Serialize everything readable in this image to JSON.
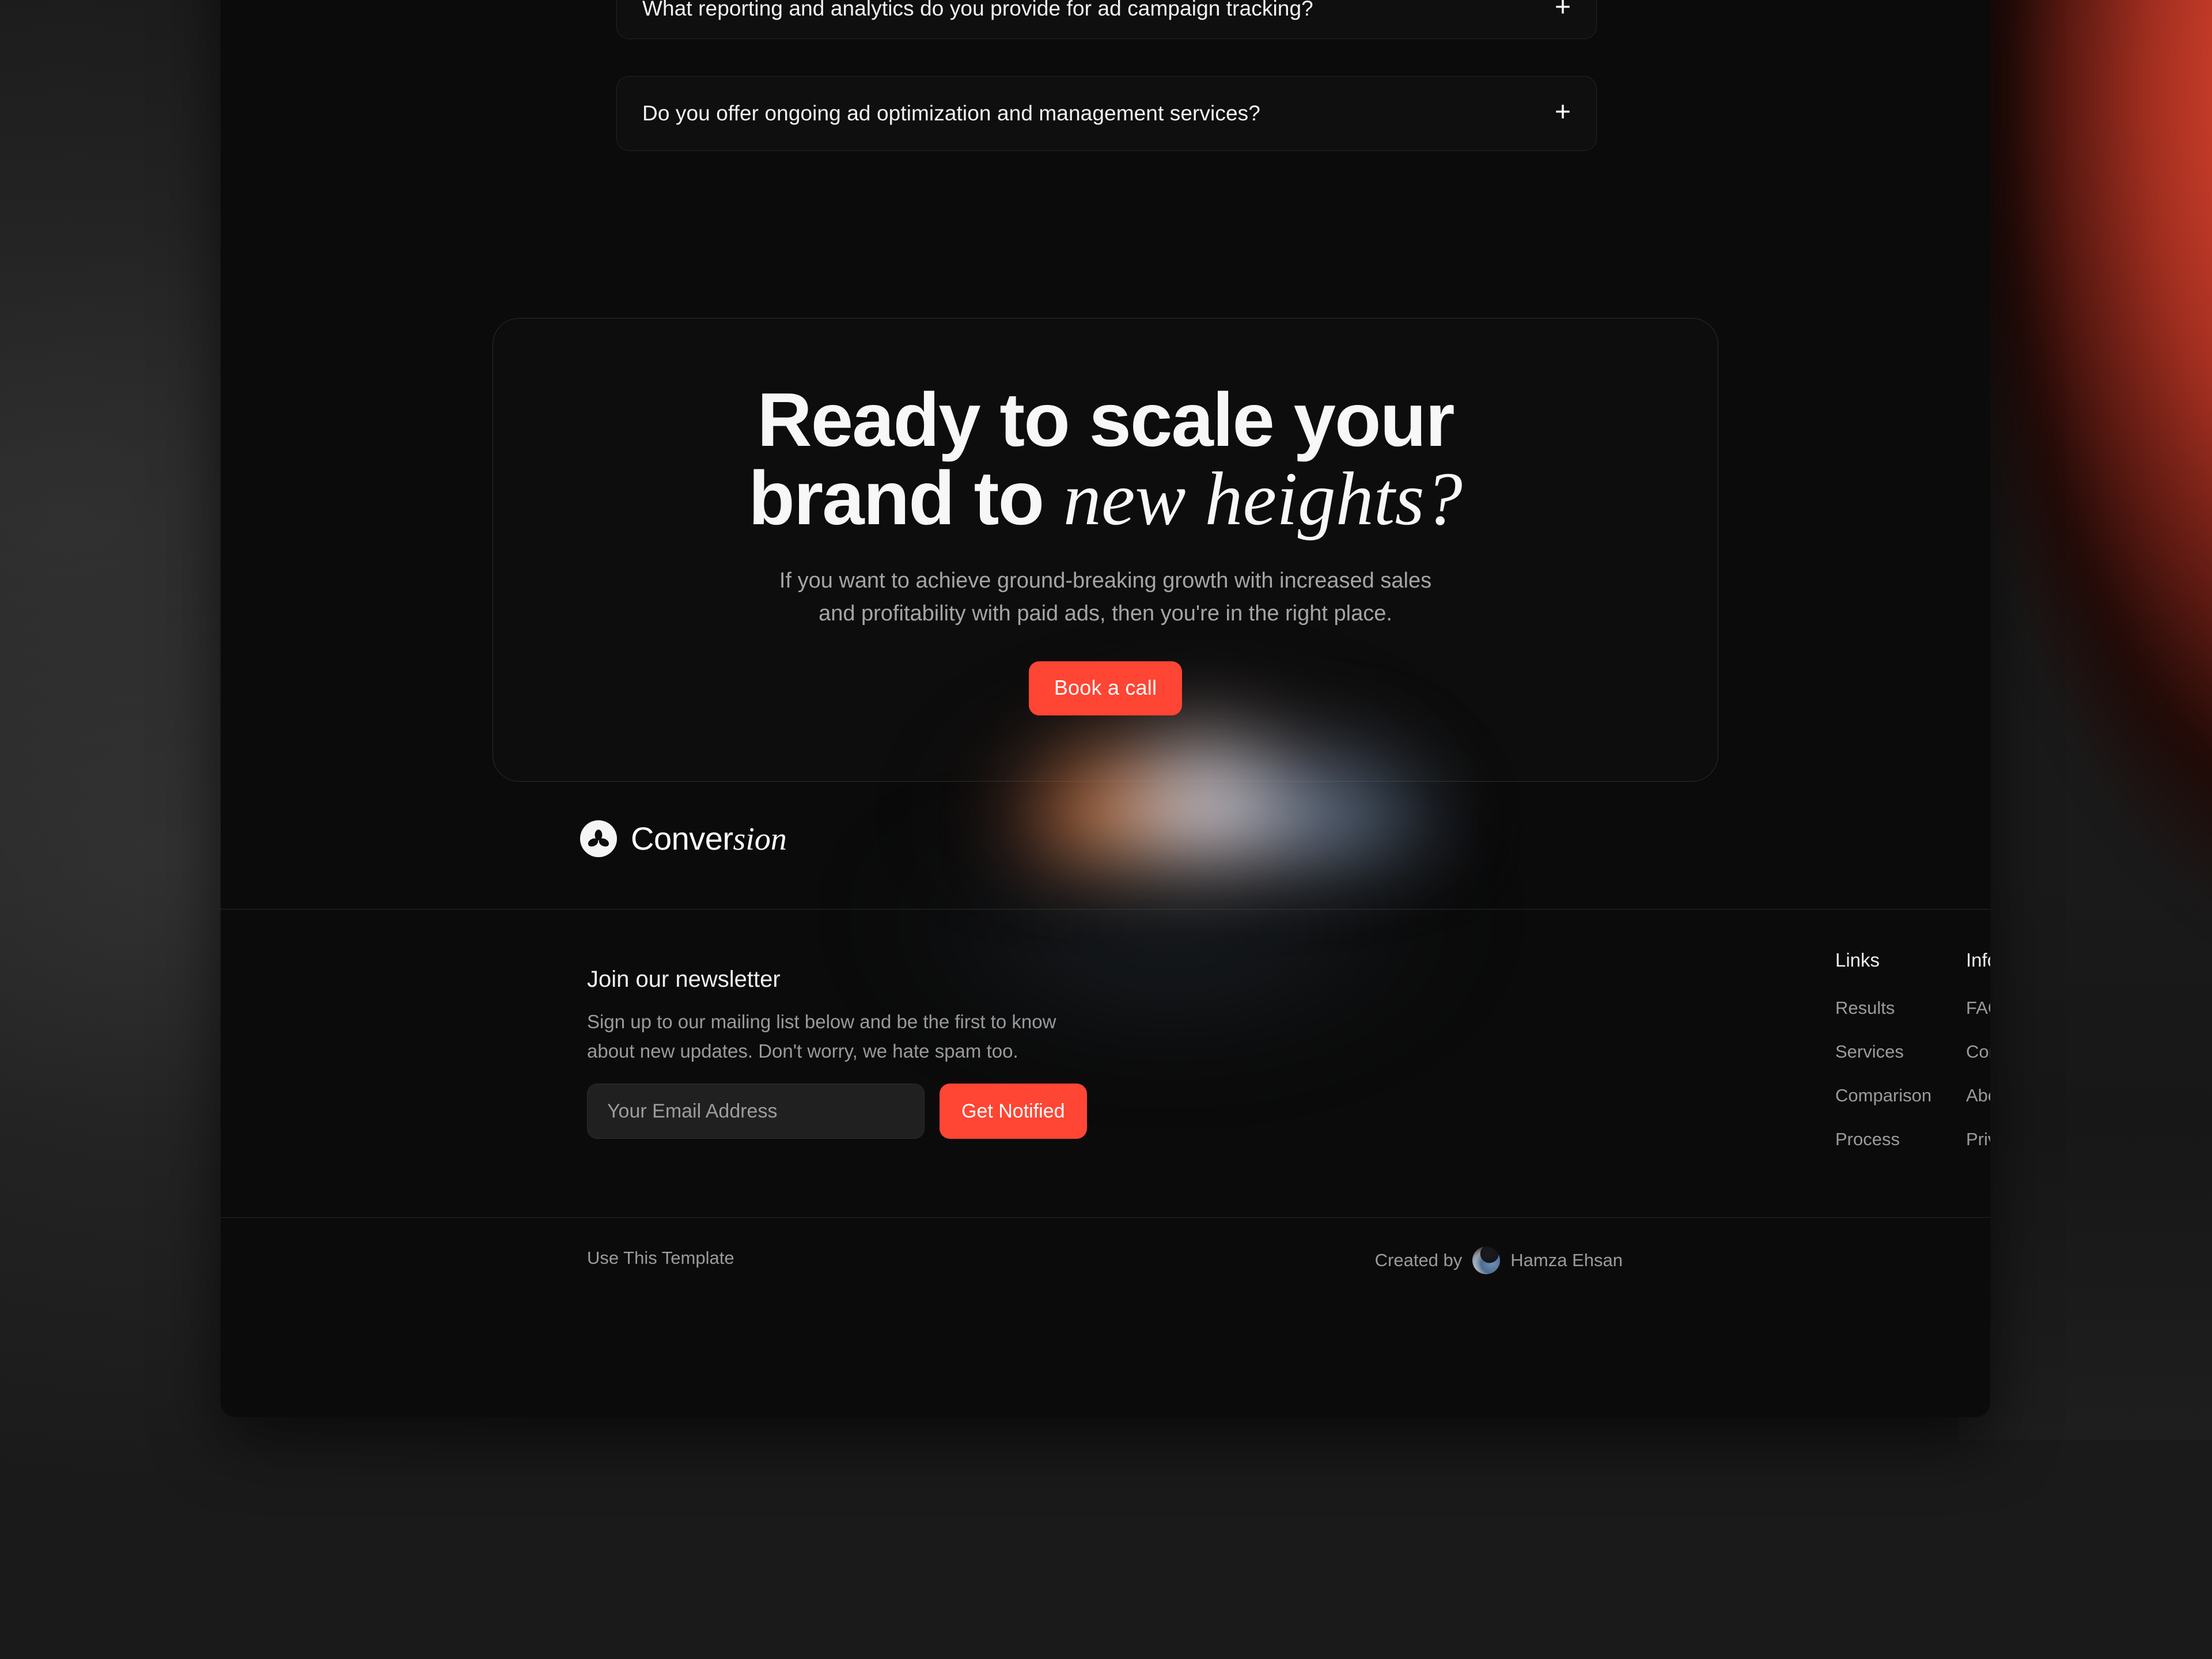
{
  "faq": {
    "items": [
      {
        "question": "What reporting and analytics do you provide for ad campaign tracking?",
        "toggle_icon": "plus-icon",
        "toggle_glyph": "+"
      },
      {
        "question": "Do you offer ongoing ad optimization and management services?",
        "toggle_icon": "plus-icon",
        "toggle_glyph": "+"
      }
    ]
  },
  "cta": {
    "heading_line1": "Ready to scale your",
    "heading_line2_plain": "brand to ",
    "heading_line2_italic": "new heights?",
    "subtitle_line1": "If you want to achieve ground-breaking growth with increased sales",
    "subtitle_line2": "and profitability with paid ads, then you're in the right place.",
    "button_label": "Book a call",
    "button_color": "#ff4533"
  },
  "footer": {
    "logo": {
      "mark_icon": "clover-leaf-logo-icon",
      "name_plain": "Conver",
      "name_italic": "sion"
    },
    "newsletter": {
      "title": "Join our newsletter",
      "description_line1": "Sign up to our mailing list below and be the first to know",
      "description_line2": "about new updates. Don't worry, we hate spam too.",
      "email_placeholder": "Your Email Address",
      "email_value": "",
      "submit_label": "Get Notified",
      "submit_color": "#ff4533"
    },
    "columns": [
      {
        "title": "Links",
        "links": [
          "Results",
          "Services",
          "Comparison",
          "Process"
        ]
      },
      {
        "title": "Information",
        "links": [
          "FAQ",
          "Contact Us",
          "About Us",
          "Privacy Policy"
        ]
      }
    ],
    "bottom": {
      "use_template_label": "Use This Template",
      "created_by_label": "Created by",
      "author_name": "Hamza Ehsan",
      "author_avatar_icon": "author-avatar-photo"
    }
  },
  "theme": {
    "page_background": "#0b0b0b",
    "accent": "#ff4533",
    "ambient_light": "#d2402c"
  }
}
